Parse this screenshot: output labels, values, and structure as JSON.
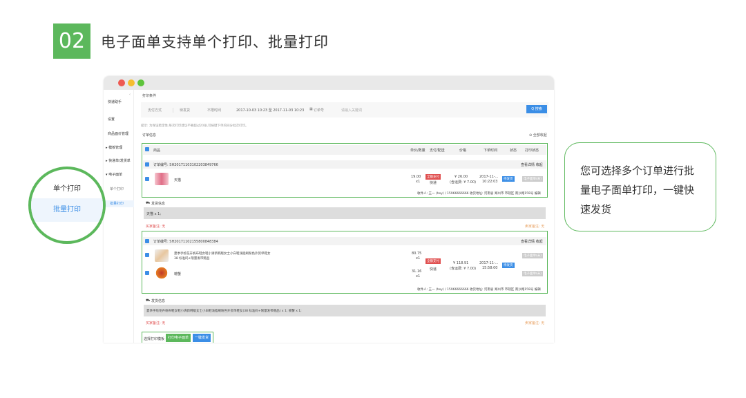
{
  "header": {
    "step": "02",
    "title": "电子面单支持单个打印、批量打印"
  },
  "sidebar": {
    "items": [
      "快递助手",
      "设置",
      "商品面价管理",
      "▸ 模板管理",
      "▸ 快递单/发货单",
      "▾ 电子面单",
      "单个打印",
      "批量打印"
    ]
  },
  "filter": {
    "title": "打印条件",
    "selects": [
      "支付方式",
      "待发货",
      "不限时间",
      "订单号"
    ],
    "date_range": "2017-10-03 10:23 至 2017-11-03 10:23",
    "keyword_placeholder": "请输入关键词",
    "search": "Q 搜索",
    "tip": "提示: 为保证稳定性,每次打印建议不要超过20张,可按键下单的同分批次打印。"
  },
  "orders": {
    "title": "订单信息",
    "collapse_all": "⊖ 全部收起",
    "columns": [
      "商品",
      "单价/数量",
      "支付/配送",
      "价格",
      "下单时间",
      "状态",
      "打印状态"
    ],
    "list": [
      {
        "order_no": "订单编号: SH20171103102203849766",
        "actions": "查看详情 收起",
        "items": [
          {
            "name": "天猫",
            "price": "19.00",
            "qty": "x1"
          }
        ],
        "pay_tag": "全额支付",
        "ship": "快递",
        "total": "¥ 26.00",
        "total_note": "(含运费: ¥ 7.00)",
        "time": "2017-11-...",
        "time2": "10:22:03",
        "status": "待发货",
        "print_status": "电子面单(未)",
        "address": "收件人: 王一 (hey) / 15966666666 收货地址: 河南省 郑州市 市辖区 南沙路159号 编辑",
        "ship_info_label": "发货信息",
        "ship_info": "天猫 x 1;",
        "buyer_note": "买家备注: 无",
        "seller_note": "卖家备注: 无"
      },
      {
        "order_no": "订单编号: SH20171102155800848384",
        "actions": "查看详情 收起",
        "items": [
          {
            "name": "夏季手绘花卉帆布鞋女鞋小清新韩版女士小白鞋浅脂刷粉色外贸单鞋女",
            "name2": "38 标准码+限量发带赠品",
            "price": "80.75",
            "qty": "x1"
          },
          {
            "name": "螃蟹",
            "price": "31.16",
            "qty": "x1"
          }
        ],
        "pay_tag": "全额支付",
        "ship": "快递",
        "total": "¥ 118.91",
        "total_note": "(含运费: ¥ 7.00)",
        "time": "2017-11-...",
        "time2": "15:58:00",
        "status": "待发货",
        "print_status": "电子面单(未)",
        "print_status2": "电子面单(未)",
        "address": "收件人: 王一 (hey) / 15966666666 收货地址: 河南省 郑州市 市辖区 南沙路159号 编辑",
        "ship_info_label": "发货信息",
        "ship_info": "夏季手绘花卉帆布鞋女鞋小清新韩版女士小白鞋浅脂刷粉色外贸单鞋女(38 标准码+限量发带赠品) x 1; 螃蟹 x 1;",
        "buyer_note": "买家备注: 无",
        "seller_note": "卖家备注: 无"
      }
    ]
  },
  "footer": {
    "template_label": "选择打印模板",
    "print_btn": "打印电子面单",
    "ship_btn": "一键发货"
  },
  "zoom": {
    "item1": "单个打印",
    "item2": "批量打印"
  },
  "callout": {
    "text": "您可选择多个订单进行批量电子面单打印，一键快速发货"
  },
  "colors": {
    "accent_green": "#5cb85c",
    "blue": "#3b8ee6",
    "red": "#e05050"
  }
}
